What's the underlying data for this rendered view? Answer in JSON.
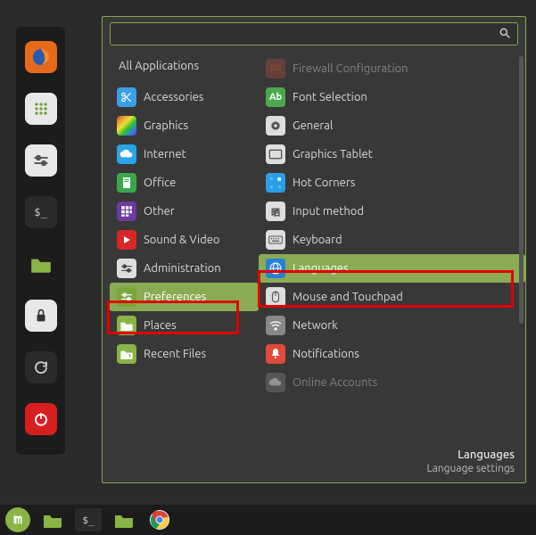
{
  "search": {
    "value": "",
    "placeholder": ""
  },
  "all_apps_label": "All Applications",
  "categories": [
    {
      "label": "Accessories",
      "icon": "scissors",
      "bg": "#3aa0e6"
    },
    {
      "label": "Graphics",
      "icon": "rainbow",
      "bg": "rainbow"
    },
    {
      "label": "Internet",
      "icon": "cloud",
      "bg": "#2aa4e8"
    },
    {
      "label": "Office",
      "icon": "doc",
      "bg": "#3aa84a"
    },
    {
      "label": "Other",
      "icon": "grid",
      "bg": "#6b3a9e"
    },
    {
      "label": "Sound & Video",
      "icon": "play",
      "bg": "#d62828"
    },
    {
      "label": "Administration",
      "icon": "slider",
      "bg": "#dedede"
    },
    {
      "label": "Preferences",
      "icon": "slider-g",
      "bg": "#7aa63a",
      "selected": true
    },
    {
      "label": "Places",
      "icon": "folder",
      "bg": "#8ab446"
    },
    {
      "label": "Recent Files",
      "icon": "folder-rc",
      "bg": "#8ab446"
    }
  ],
  "apps": [
    {
      "label": "Firewall Configuration",
      "icon": "firewall",
      "bg": "#9c4a3a",
      "dim": true
    },
    {
      "label": "Font Selection",
      "icon": "font",
      "bg": "#4aa850"
    },
    {
      "label": "General",
      "icon": "gear",
      "bg": "#dedede"
    },
    {
      "label": "Graphics Tablet",
      "icon": "tablet",
      "bg": "#dedede"
    },
    {
      "label": "Hot Corners",
      "icon": "corners",
      "bg": "#2a9fe8"
    },
    {
      "label": "Input method",
      "icon": "input",
      "bg": "#dedede"
    },
    {
      "label": "Keyboard",
      "icon": "keyboard",
      "bg": "#dedede"
    },
    {
      "label": "Languages",
      "icon": "globe",
      "bg": "#2a7fd8",
      "selected": true
    },
    {
      "label": "Mouse and Touchpad",
      "icon": "mouse",
      "bg": "#dedede"
    },
    {
      "label": "Network",
      "icon": "wifi",
      "bg": "#888888"
    },
    {
      "label": "Notifications",
      "icon": "bell",
      "bg": "#e04a3a"
    },
    {
      "label": "Online Accounts",
      "icon": "cloud2",
      "bg": "#7a7a7a",
      "dim": true
    }
  ],
  "footer": {
    "title": "Languages",
    "subtitle": "Language settings"
  },
  "dock": [
    {
      "name": "firefox",
      "bg": "#e66a1a"
    },
    {
      "name": "apps",
      "bg": "#e8e8e8"
    },
    {
      "name": "settings",
      "bg": "#e8e8e8"
    },
    {
      "name": "terminal",
      "bg": "#2a2a2a"
    },
    {
      "name": "files",
      "bg": "#8ab446"
    },
    {
      "name": "lock",
      "bg": "#e8e8e8"
    },
    {
      "name": "update",
      "bg": "#2a2a2a"
    },
    {
      "name": "power",
      "bg": "#d62020"
    }
  ],
  "taskbar": [
    {
      "name": "mint-menu",
      "bg": "#8ab446"
    },
    {
      "name": "files",
      "bg": "#8ab446"
    },
    {
      "name": "terminal",
      "bg": "#2a2a2a"
    },
    {
      "name": "folder",
      "bg": "#8ab446"
    },
    {
      "name": "chrome",
      "bg": "chrome"
    }
  ]
}
